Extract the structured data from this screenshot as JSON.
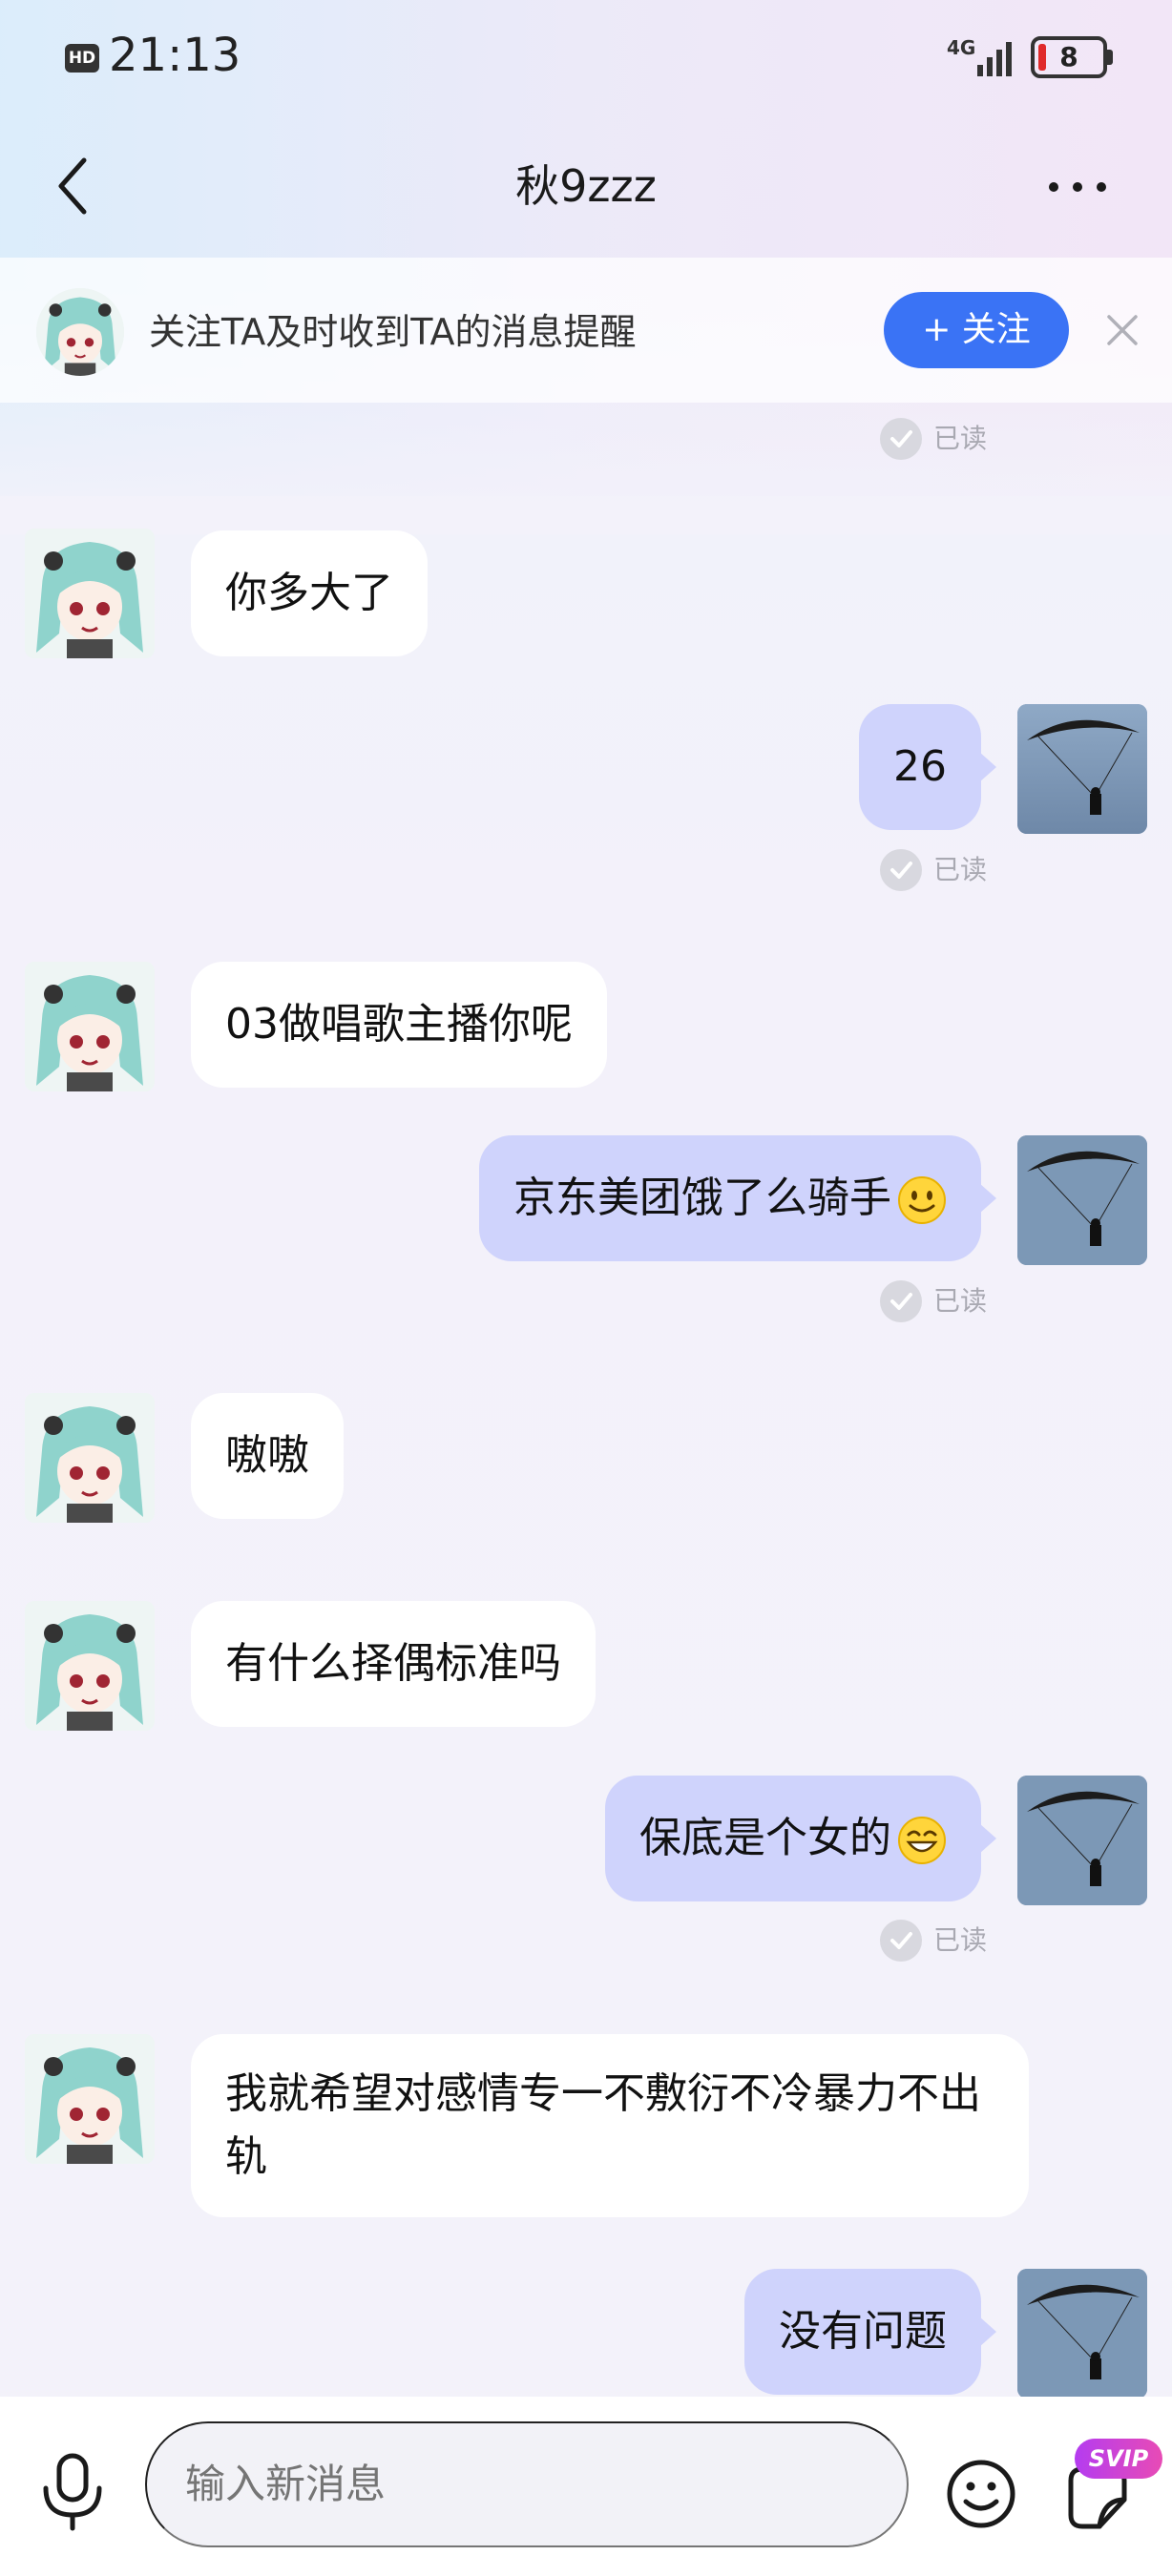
{
  "status_bar": {
    "hd": "HD",
    "time": "21:13",
    "network": "4G",
    "battery": "8"
  },
  "header": {
    "title": "秋9zzz",
    "back_icon": "back-chevron-icon",
    "more_icon": "more-dots-icon"
  },
  "follow_banner": {
    "text": "关注TA及时收到TA的消息提醒",
    "button_label": "+ 关注",
    "close_icon": "close-icon"
  },
  "messages": [
    {
      "type": "read_receipt",
      "text": "已读"
    },
    {
      "type": "incoming",
      "text": "你多大了"
    },
    {
      "type": "outgoing",
      "text": "26"
    },
    {
      "type": "read_receipt",
      "text": "已读"
    },
    {
      "type": "incoming",
      "text": "03做唱歌主播你呢"
    },
    {
      "type": "outgoing",
      "text": "京东美团饿了么骑手",
      "emoji": "smile-emoji"
    },
    {
      "type": "read_receipt",
      "text": "已读"
    },
    {
      "type": "incoming",
      "text": "嗷嗷"
    },
    {
      "type": "incoming",
      "text": "有什么择偶标准吗"
    },
    {
      "type": "outgoing",
      "text": "保底是个女的",
      "emoji": "grin-emoji"
    },
    {
      "type": "read_receipt",
      "text": "已读"
    },
    {
      "type": "incoming",
      "text": "我就希望对感情专一不敷衍不冷暴力不出轨"
    },
    {
      "type": "outgoing",
      "text": "没有问题"
    }
  ],
  "input_bar": {
    "placeholder": "输入新消息",
    "voice_icon": "microphone-icon",
    "emoji_icon": "smiley-icon",
    "sticker_icon": "sticker-icon",
    "svip_label": "SVIP"
  },
  "colors": {
    "accent": "#3a73f5",
    "outgoing_bubble": "#cfd3fc",
    "incoming_bubble": "#ffffff",
    "battery_low": "#e02a2a"
  }
}
